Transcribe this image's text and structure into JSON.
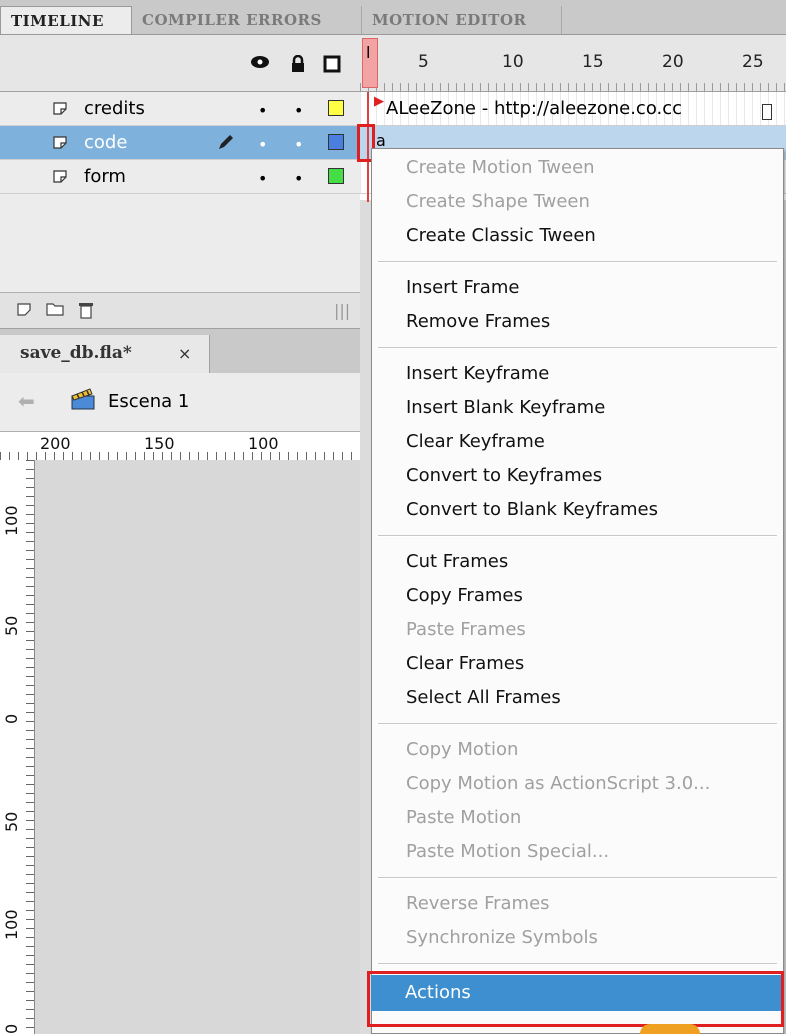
{
  "tabs": [
    "TIMELINE",
    "COMPILER ERRORS",
    "MOTION EDITOR"
  ],
  "timeline": {
    "header_icons": [
      "eye-icon",
      "lock-icon",
      "outline-icon"
    ],
    "frame_numbers": [
      "5",
      "10",
      "15",
      "20",
      "25"
    ],
    "playhead_label": "l",
    "layers": [
      {
        "name": "credits",
        "color": "#ffff44",
        "selected": false
      },
      {
        "name": "code",
        "color": "#4a7fe0",
        "selected": true
      },
      {
        "name": "form",
        "color": "#44dd44",
        "selected": false
      }
    ],
    "credits_frame_text": "ALeeZone - http://aleezone.co.cc",
    "code_frame_text": "a"
  },
  "document": {
    "tab_label": "save_db.fla*",
    "close_glyph": "×",
    "scene_label": "Escena 1"
  },
  "rulers": {
    "horizontal": [
      "200",
      "150",
      "100"
    ],
    "vertical": [
      "100",
      "50",
      "0",
      "50",
      "100",
      "0"
    ]
  },
  "context_menu": {
    "groups": [
      [
        {
          "label": "Create Motion Tween",
          "enabled": false
        },
        {
          "label": "Create Shape Tween",
          "enabled": false
        },
        {
          "label": "Create Classic Tween",
          "enabled": true
        }
      ],
      [
        {
          "label": "Insert Frame",
          "enabled": true
        },
        {
          "label": "Remove Frames",
          "enabled": true
        }
      ],
      [
        {
          "label": "Insert Keyframe",
          "enabled": true
        },
        {
          "label": "Insert Blank Keyframe",
          "enabled": true
        },
        {
          "label": "Clear Keyframe",
          "enabled": true
        },
        {
          "label": "Convert to Keyframes",
          "enabled": true
        },
        {
          "label": "Convert to Blank Keyframes",
          "enabled": true
        }
      ],
      [
        {
          "label": "Cut Frames",
          "enabled": true
        },
        {
          "label": "Copy Frames",
          "enabled": true
        },
        {
          "label": "Paste Frames",
          "enabled": false
        },
        {
          "label": "Clear Frames",
          "enabled": true
        },
        {
          "label": "Select All Frames",
          "enabled": true
        }
      ],
      [
        {
          "label": "Copy Motion",
          "enabled": false
        },
        {
          "label": "Copy Motion as ActionScript 3.0...",
          "enabled": false
        },
        {
          "label": "Paste Motion",
          "enabled": false
        },
        {
          "label": "Paste Motion Special...",
          "enabled": false
        }
      ],
      [
        {
          "label": "Reverse Frames",
          "enabled": false
        },
        {
          "label": "Synchronize Symbols",
          "enabled": false
        }
      ]
    ],
    "highlighted_item": "Actions"
  },
  "colors": {
    "selection": "#7eb2dd",
    "menu_highlight": "#3d8fcf",
    "annotation_red": "#e02020"
  }
}
